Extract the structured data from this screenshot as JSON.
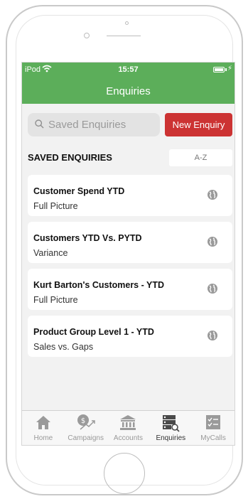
{
  "status_bar": {
    "carrier": "iPod",
    "time": "15:57"
  },
  "header": {
    "title": "Enquiries"
  },
  "search": {
    "placeholder": "Saved Enquiries",
    "value": ""
  },
  "actions": {
    "new_enquiry_label": "New Enquiry"
  },
  "section": {
    "title": "SAVED ENQUIRIES",
    "sort_label": "A-Z"
  },
  "enquiries": [
    {
      "name": "Customer Spend YTD",
      "subtitle": "Full Picture"
    },
    {
      "name": "Customers YTD Vs. PYTD",
      "subtitle": "Variance"
    },
    {
      "name": "Kurt Barton's Customers - YTD",
      "subtitle": "Full Picture"
    },
    {
      "name": "Product Group Level 1 - YTD",
      "subtitle": "Sales vs. Gaps"
    }
  ],
  "tabs": [
    {
      "label": "Home",
      "icon": "home-icon"
    },
    {
      "label": "Campaigns",
      "icon": "campaigns-icon"
    },
    {
      "label": "Accounts",
      "icon": "bank-icon"
    },
    {
      "label": "Enquiries",
      "icon": "enquiries-icon",
      "active": true
    },
    {
      "label": "MyCalls",
      "icon": "checklist-icon"
    }
  ],
  "colors": {
    "header": "#5cae5a",
    "new_button": "#cc3333",
    "background": "#f2f2f2"
  }
}
